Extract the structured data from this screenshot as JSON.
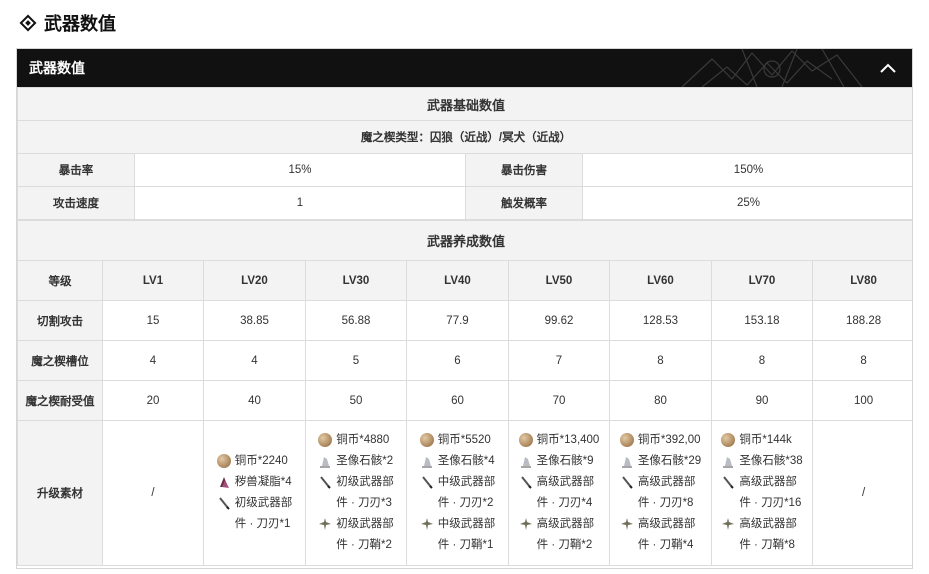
{
  "page": {
    "heading": "武器数值"
  },
  "panel": {
    "title": "武器数值"
  },
  "basic": {
    "section_title": "武器基础数值",
    "demon_type": "魔之楔类型：囚狼（近战）/冥犬（近战）",
    "rows": [
      {
        "label1": "暴击率",
        "value1": "15%",
        "label2": "暴击伤害",
        "value2": "150%"
      },
      {
        "label1": "攻击速度",
        "value1": "1",
        "label2": "触发概率",
        "value2": "25%"
      }
    ]
  },
  "growth": {
    "section_title": "武器养成数值",
    "level_label": "等级",
    "levels": [
      "LV1",
      "LV20",
      "LV30",
      "LV40",
      "LV50",
      "LV60",
      "LV70",
      "LV80"
    ],
    "rows": [
      {
        "label": "切割攻击",
        "values": [
          "15",
          "38.85",
          "56.88",
          "77.9",
          "99.62",
          "128.53",
          "153.18",
          "188.28"
        ]
      },
      {
        "label": "魔之楔槽位",
        "values": [
          "4",
          "4",
          "5",
          "6",
          "7",
          "8",
          "8",
          "8"
        ]
      },
      {
        "label": "魔之楔耐受值",
        "values": [
          "20",
          "40",
          "50",
          "60",
          "70",
          "80",
          "90",
          "100"
        ]
      }
    ],
    "materials_label": "升级素材",
    "materials": [
      {
        "none": "/"
      },
      {
        "items": [
          {
            "icon": "coin-icon",
            "text": "铜币*2240"
          },
          {
            "icon": "grease-icon",
            "text": "秽兽凝脂*4"
          },
          {
            "icon": "blade-icon",
            "text": "初级武器部\n件 · 刀刃*1"
          }
        ]
      },
      {
        "items": [
          {
            "icon": "coin-icon",
            "text": "铜币*4880"
          },
          {
            "icon": "statue-stone-icon",
            "text": "圣像石骸*2"
          },
          {
            "icon": "blade-icon",
            "text": "初级武器部\n件 · 刀刃*3"
          },
          {
            "icon": "hilt-icon",
            "text": "初级武器部\n件 · 刀鞘*2"
          }
        ]
      },
      {
        "items": [
          {
            "icon": "coin-icon",
            "text": "铜币*5520"
          },
          {
            "icon": "statue-stone-icon",
            "text": "圣像石骸*4"
          },
          {
            "icon": "blade-icon",
            "text": "中级武器部\n件 · 刀刃*2"
          },
          {
            "icon": "hilt-icon",
            "text": "中级武器部\n件 · 刀鞘*1"
          }
        ]
      },
      {
        "items": [
          {
            "icon": "coin-icon",
            "text": "铜币*13,400"
          },
          {
            "icon": "statue-stone-icon",
            "text": "圣像石骸*9"
          },
          {
            "icon": "blade-icon",
            "text": "高级武器部\n件 · 刀刃*4"
          },
          {
            "icon": "hilt-icon",
            "text": "高级武器部\n件 · 刀鞘*2"
          }
        ]
      },
      {
        "items": [
          {
            "icon": "coin-icon",
            "text": "铜币*392,00"
          },
          {
            "icon": "statue-stone-icon",
            "text": "圣像石骸*29"
          },
          {
            "icon": "blade-icon",
            "text": "高级武器部\n件 · 刀刃*8"
          },
          {
            "icon": "hilt-icon",
            "text": "高级武器部\n件 · 刀鞘*4"
          }
        ]
      },
      {
        "items": [
          {
            "icon": "coin-icon",
            "text": "铜币*144k"
          },
          {
            "icon": "statue-stone-icon",
            "text": "圣像石骸*38"
          },
          {
            "icon": "blade-icon",
            "text": "高级武器部\n件 · 刀刃*16"
          },
          {
            "icon": "hilt-icon",
            "text": "高级武器部\n件 · 刀鞘*8"
          }
        ]
      },
      {
        "none": "/"
      }
    ]
  },
  "colors": {
    "header_bg": "#111111",
    "cell_label_bg": "#f3f3f3",
    "border": "#dcdcdc"
  }
}
